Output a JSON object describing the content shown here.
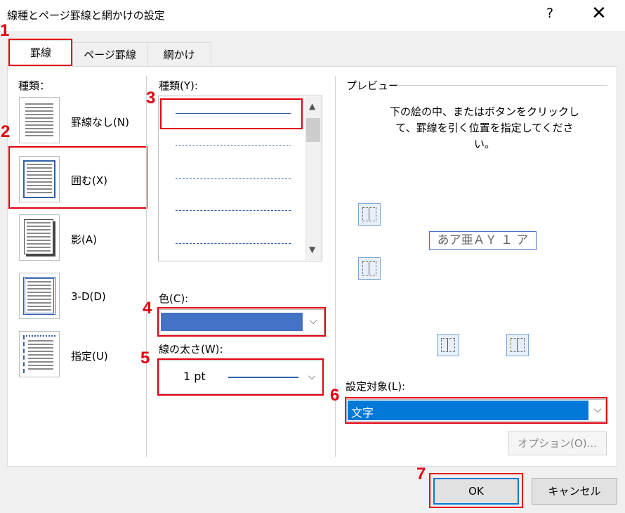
{
  "window": {
    "title": "線種とページ罫線と網かけの設定",
    "help_label": "?",
    "close_label": "✕"
  },
  "tabs": [
    "罫線",
    "ページ罫線",
    "網かけ"
  ],
  "left": {
    "heading": "種類：",
    "options": [
      {
        "label": "罫線なし(N)",
        "name": "none"
      },
      {
        "label": "囲む(X)",
        "name": "box"
      },
      {
        "label": "影(A)",
        "name": "shadow"
      },
      {
        "label": "3-D(D)",
        "name": "3d"
      },
      {
        "label": "指定(U)",
        "name": "custom"
      }
    ]
  },
  "middle": {
    "style_heading": "種類(Y):",
    "color_label": "色(C):",
    "color_value": "#4472c4",
    "width_label": "線の太さ(W):",
    "width_value": "1 pt"
  },
  "preview": {
    "heading": "プレビュー",
    "instructions": "下の絵の中、またはボタンをクリックして、罫線を引く位置を指定してください。",
    "sample_text": "あア亜ＡＹ １ ア"
  },
  "apply_to": {
    "label": "設定対象(L):",
    "value": "文字"
  },
  "buttons": {
    "options": "オプション(O)...",
    "ok": "OK",
    "cancel": "キャンセル"
  },
  "annotations": [
    "1",
    "2",
    "3",
    "4",
    "5",
    "6",
    "7"
  ],
  "colors": {
    "highlight": "#e2000f",
    "selection": "#0078d7",
    "accent": "#4472c4"
  }
}
